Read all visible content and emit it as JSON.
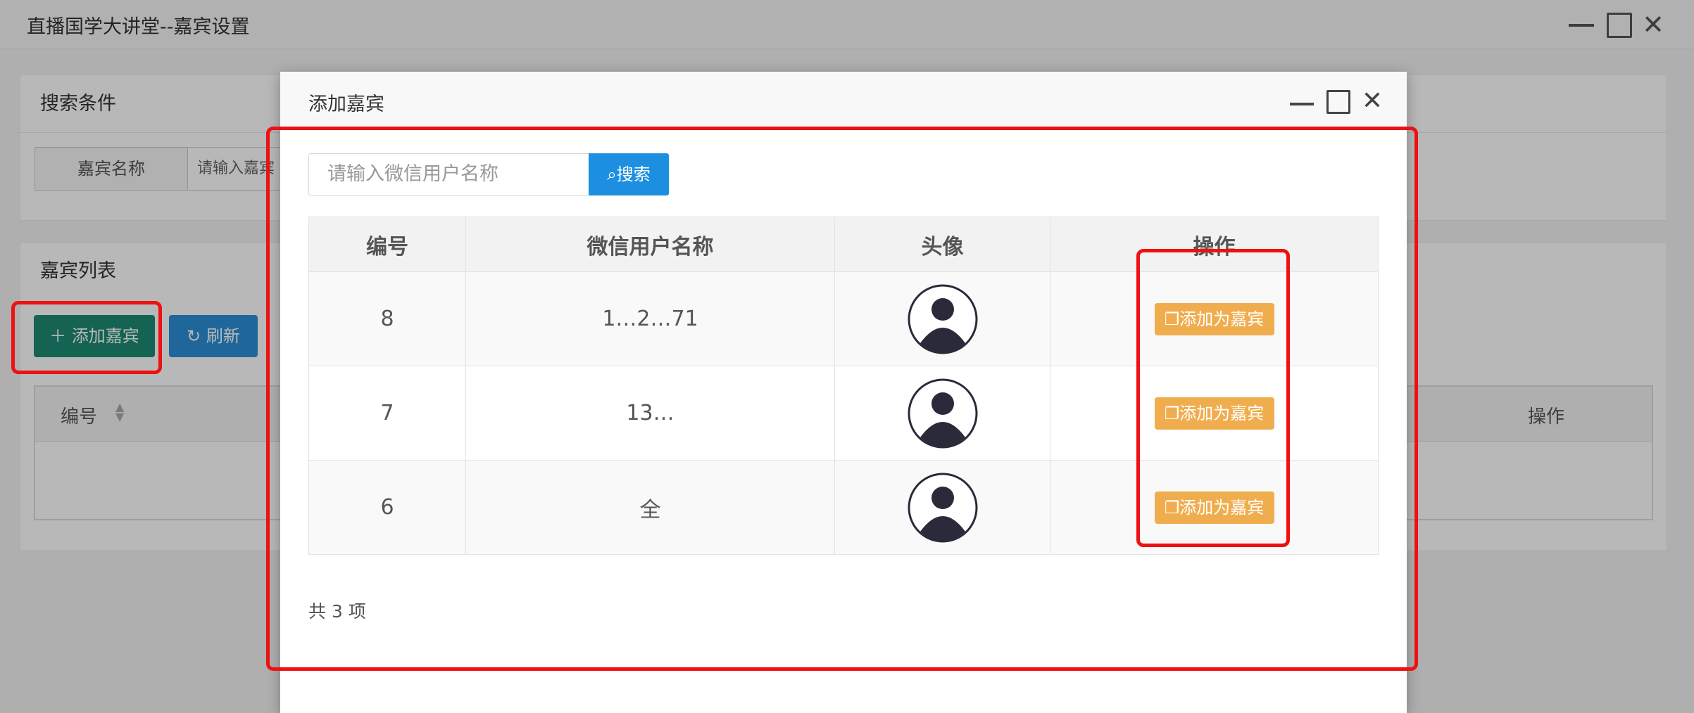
{
  "window": {
    "title": "直播国学大讲堂--嘉宾设置"
  },
  "search_panel": {
    "title": "搜索条件",
    "label": "嘉宾名称",
    "placeholder": "请输入嘉宾"
  },
  "list_panel": {
    "title": "嘉宾列表",
    "add_label": "添加嘉宾",
    "refresh_label": "刷新",
    "columns": {
      "no": "编号",
      "op": "操作"
    }
  },
  "modal": {
    "title": "添加嘉宾",
    "search": {
      "placeholder": "请输入微信用户名称",
      "button_label": "搜索"
    },
    "columns": {
      "no": "编号",
      "name": "微信用户名称",
      "avatar": "头像",
      "op": "操作"
    },
    "rows": [
      {
        "no": "8",
        "name": "1…2…71",
        "action": "添加为嘉宾"
      },
      {
        "no": "7",
        "name": "13…",
        "action": "添加为嘉宾"
      },
      {
        "no": "6",
        "name": "全",
        "action": "添加为嘉宾"
      }
    ],
    "count_text": "共 3 项"
  },
  "colors": {
    "primary": "#1c8a74",
    "info": "#2c8fd6",
    "warning": "#f0ad4e",
    "annotation": "#ee1111"
  },
  "icons": [
    "minimize-icon",
    "maximize-icon",
    "close-icon",
    "plus-icon",
    "refresh-icon",
    "search-icon",
    "copy-icon",
    "avatar-icon",
    "sort-icon"
  ]
}
